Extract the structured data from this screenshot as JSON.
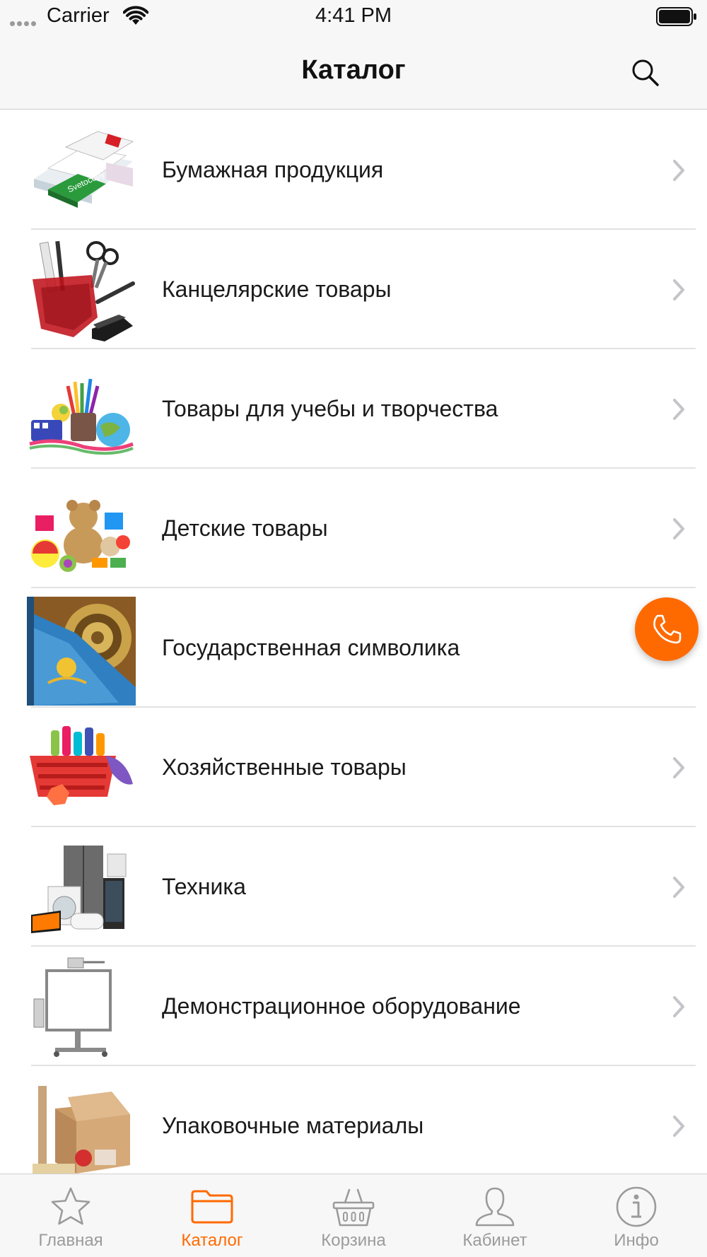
{
  "status_bar": {
    "carrier": "Carrier",
    "time": "4:41 PM"
  },
  "nav": {
    "title": "Каталог",
    "search_icon": "search-icon"
  },
  "categories": [
    {
      "label": "Бумажная продукция",
      "icon": "paper-products-thumbnail"
    },
    {
      "label": "Канцелярские товары",
      "icon": "stationery-thumbnail"
    },
    {
      "label": "Товары для учебы и творчества",
      "icon": "school-supplies-thumbnail"
    },
    {
      "label": "Детские товары",
      "icon": "toys-thumbnail"
    },
    {
      "label": "Государственная символика",
      "icon": "state-symbols-thumbnail"
    },
    {
      "label": "Хозяйственные товары",
      "icon": "household-goods-thumbnail"
    },
    {
      "label": "Техника",
      "icon": "appliances-thumbnail"
    },
    {
      "label": "Демонстрационное оборудование",
      "icon": "whiteboard-thumbnail"
    },
    {
      "label": "Упаковочные материалы",
      "icon": "packaging-thumbnail"
    }
  ],
  "fab": {
    "icon": "phone-icon"
  },
  "tabs": [
    {
      "label": "Главная",
      "icon": "star-icon",
      "active": false
    },
    {
      "label": "Каталог",
      "icon": "folder-icon",
      "active": true
    },
    {
      "label": "Корзина",
      "icon": "basket-icon",
      "active": false
    },
    {
      "label": "Кабинет",
      "icon": "user-icon",
      "active": false
    },
    {
      "label": "Инфо",
      "icon": "info-icon",
      "active": false
    }
  ],
  "colors": {
    "accent": "#ff6a00",
    "tab_inactive": "#9b9b9b",
    "bar_background": "#f7f7f7"
  }
}
